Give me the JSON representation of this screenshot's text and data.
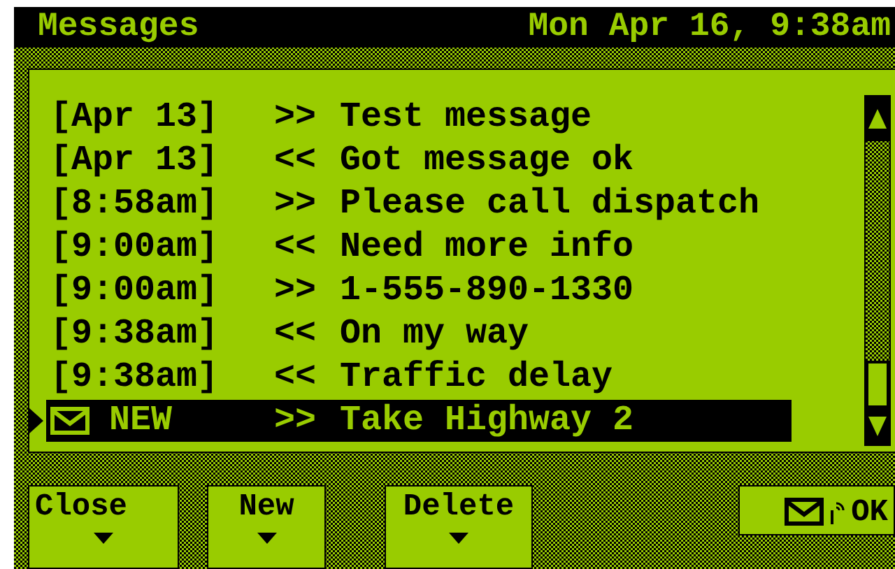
{
  "title_bar": {
    "title": "Messages",
    "datetime": "Mon Apr 16, 9:38am"
  },
  "messages": [
    {
      "time": "[Apr 13]",
      "direction": ">>",
      "text": "Test message",
      "unread": false,
      "selected": false
    },
    {
      "time": "[Apr 13]",
      "direction": "<<",
      "text": "Got message ok",
      "unread": false,
      "selected": false
    },
    {
      "time": "[8:58am]",
      "direction": ">>",
      "text": "Please call dispatch",
      "unread": false,
      "selected": false
    },
    {
      "time": "[9:00am]",
      "direction": "<<",
      "text": "Need more info",
      "unread": false,
      "selected": false
    },
    {
      "time": "[9:00am]",
      "direction": ">>",
      "text": "1-555-890-1330",
      "unread": false,
      "selected": false
    },
    {
      "time": "[9:38am]",
      "direction": "<<",
      "text": "On my way",
      "unread": false,
      "selected": false
    },
    {
      "time": "[9:38am]",
      "direction": "<<",
      "text": "Traffic delay",
      "unread": false,
      "selected": false
    },
    {
      "time": "NEW",
      "direction": ">>",
      "text": "Take Highway 2",
      "unread": true,
      "selected": true
    }
  ],
  "buttons": [
    {
      "label": "Close",
      "kind": "menu"
    },
    {
      "label": "New",
      "kind": "menu"
    },
    {
      "label": "Delete",
      "kind": "menu"
    },
    {
      "label": "OK",
      "kind": "send"
    }
  ]
}
